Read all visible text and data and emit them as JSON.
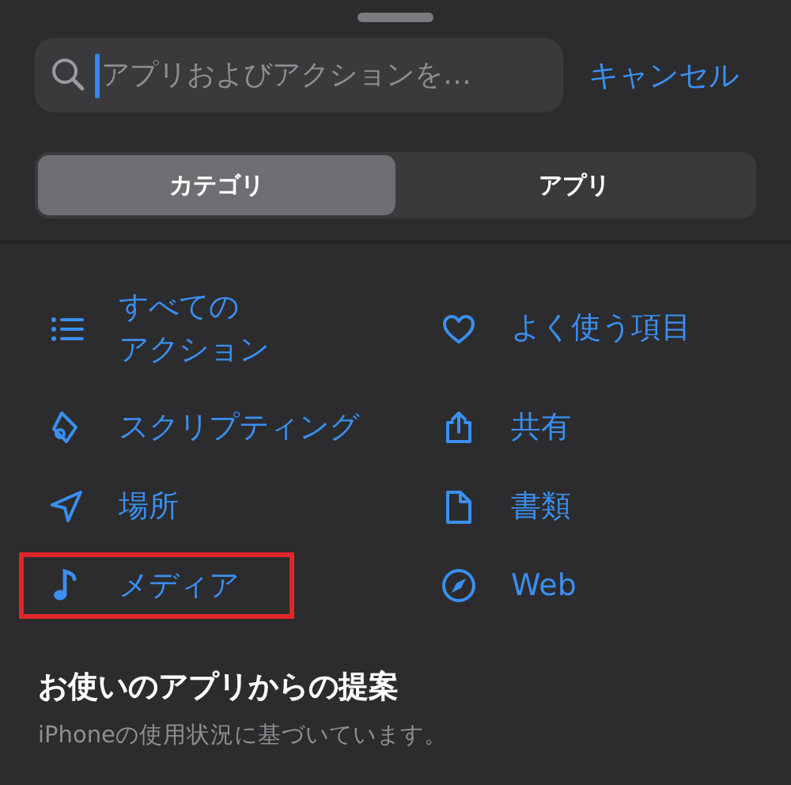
{
  "search": {
    "placeholder": "アプリおよびアクションを…",
    "focused": true
  },
  "cancel": "キャンセル",
  "segments": [
    {
      "label": "カテゴリ",
      "selected": true
    },
    {
      "label": "アプリ",
      "selected": false
    }
  ],
  "categories": [
    {
      "lines": [
        "すべての",
        "アクション"
      ],
      "kind": "list",
      "highlighted": false
    },
    {
      "label": "よく使う項目",
      "kind": "heart",
      "highlighted": false
    },
    {
      "label": "スクリプティング",
      "kind": "scroll",
      "highlighted": false
    },
    {
      "label": "共有",
      "kind": "share",
      "highlighted": false
    },
    {
      "label": "場所",
      "kind": "location",
      "highlighted": false
    },
    {
      "label": "書類",
      "kind": "document",
      "highlighted": false
    },
    {
      "label": "メディア",
      "kind": "music",
      "highlighted": true
    },
    {
      "label": "Web",
      "kind": "compass",
      "highlighted": false
    }
  ],
  "suggestions": {
    "title": "お使いのアプリからの提案",
    "subtitle": "iPhoneの使用状況に基づいています。"
  }
}
